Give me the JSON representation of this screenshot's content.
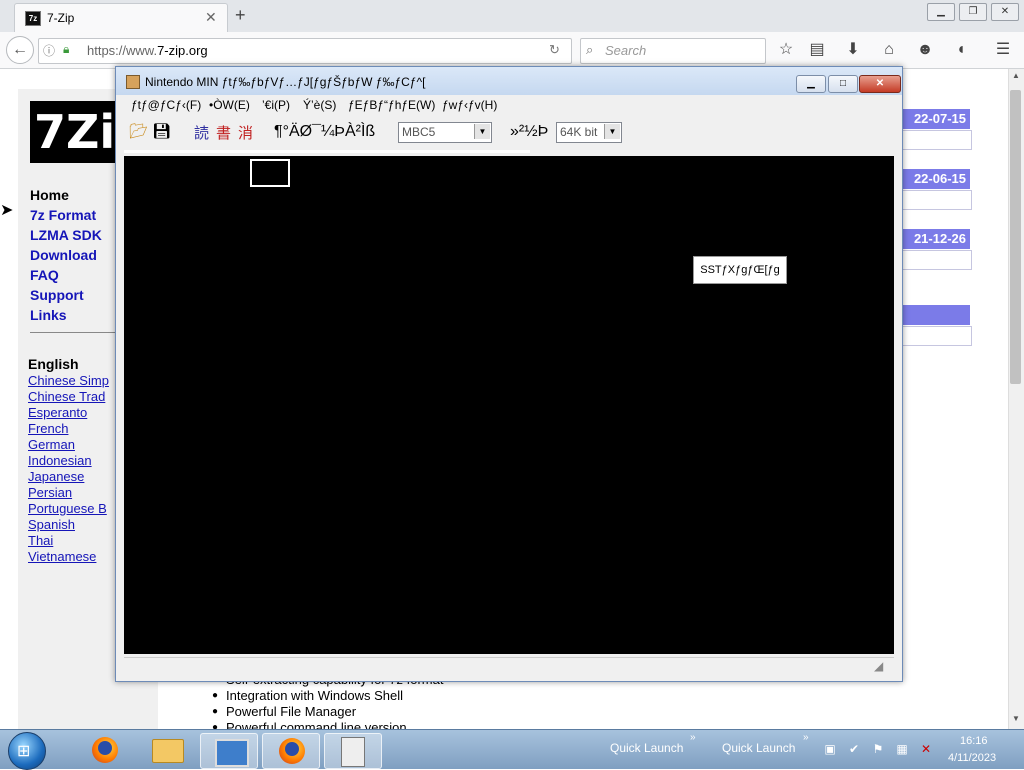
{
  "browser": {
    "tab_title": "7-Zip",
    "tab_favicon": "7z",
    "url_prefix": "https://www.",
    "url_domain": "7-zip.org",
    "search_placeholder": "Search"
  },
  "page": {
    "logo_text": "7Zi",
    "nav": [
      "Home",
      "7z Format",
      "LZMA SDK",
      "Download",
      "FAQ",
      "Support",
      "Links"
    ],
    "languages_heading": "English",
    "languages": [
      "Chinese Simp",
      "Chinese Trad",
      "Esperanto",
      "French",
      "German",
      "Indonesian",
      "Japanese",
      "Persian",
      "Portuguese B",
      "Spanish",
      "Thai",
      "Vietnamese"
    ],
    "dates": [
      "22-07-15",
      "22-06-15",
      "21-12-26"
    ],
    "features": [
      "Self-extracting capability for 7z format",
      "Integration with Windows Shell",
      "Powerful File Manager",
      "Powerful command line version"
    ]
  },
  "emulator": {
    "title": "Nintendo MIN ƒtƒ‰ƒbƒVƒ…ƒJ[ƒgƒŠƒbƒW ƒ‰ƒCƒ^[",
    "menus": [
      "ƒtƒ@ƒCƒ‹(F)",
      "•ÒW(E)",
      "’€i(P)",
      "Ý’è(S)",
      "ƒEƒBƒ“ƒhƒE(W)",
      "ƒwƒ‹ƒv(H)"
    ],
    "toolbar_kanji": [
      "読",
      "書",
      "消"
    ],
    "toolbar_label1": "¶°ÄØ¯¼ÞÀ²Ìß",
    "combo1_value": "MBC5",
    "toolbar_label2": "»²½Þ",
    "combo2_value": "64K bit",
    "tooltip": "SSTƒXƒgƒŒ[ƒg"
  },
  "taskbar": {
    "quick_launch_1": "Quick Launch",
    "quick_launch_2": "Quick Launch",
    "time": "16:16",
    "date": "4/11/2023"
  }
}
